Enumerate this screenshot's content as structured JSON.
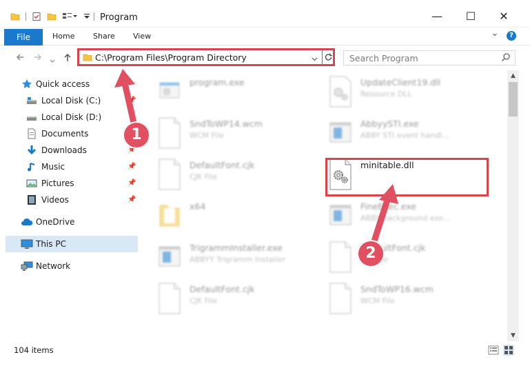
{
  "window": {
    "title": "Program",
    "minimize": "—",
    "maximize": "☐",
    "close": "✕"
  },
  "ribbon": {
    "tabs": [
      "File",
      "Home",
      "Share",
      "View"
    ],
    "collapse": "⌄",
    "help": "?"
  },
  "address": {
    "path": "C:\\Program Files\\Program Directory",
    "search_placeholder": "Search Program"
  },
  "sidebar": {
    "items": [
      {
        "label": "Quick access",
        "icon": "star-icon"
      },
      {
        "label": "Local Disk (C:)",
        "icon": "drive-icon"
      },
      {
        "label": "Local Disk (D:)",
        "icon": "drive-icon"
      },
      {
        "label": "Documents",
        "icon": "documents-icon"
      },
      {
        "label": "Downloads",
        "icon": "downloads-icon"
      },
      {
        "label": "Music",
        "icon": "music-icon"
      },
      {
        "label": "Pictures",
        "icon": "pictures-icon"
      },
      {
        "label": "Videos",
        "icon": "videos-icon"
      },
      {
        "label": "OneDrive",
        "icon": "cloud-icon"
      },
      {
        "label": "This PC",
        "icon": "computer-icon"
      },
      {
        "label": "Network",
        "icon": "network-icon"
      }
    ]
  },
  "files": {
    "left": [
      {
        "name": "program.exe",
        "type": ""
      },
      {
        "name": "SndToWP14.wcm",
        "type": "WCM File"
      },
      {
        "name": "DefaultFont.cjk",
        "type": "CJK File"
      },
      {
        "name": "x64",
        "type": ""
      },
      {
        "name": "TrigrammInstaller.exe",
        "type": "ABBYY Trigramm Installer"
      },
      {
        "name": "DefaultFont.cjk",
        "type": "CJK File"
      }
    ],
    "right": [
      {
        "name": "UpdateClient19.dll",
        "type": "Resource DLL"
      },
      {
        "name": "AbbyySTI.exe",
        "type": "ABBY STI event handl..."
      },
      {
        "name": "minitable.dll",
        "type": ""
      },
      {
        "name": "FineExec.exe",
        "type": "ABBY background exe..."
      },
      {
        "name": "DefaultFont.cjk",
        "type": "CJK File"
      },
      {
        "name": "SndToWP16.wcm",
        "type": "WCM File"
      }
    ]
  },
  "status": {
    "item_count": "104 items"
  },
  "annotations": {
    "marker_1": "1",
    "marker_2": "2",
    "color": "#e05060"
  }
}
